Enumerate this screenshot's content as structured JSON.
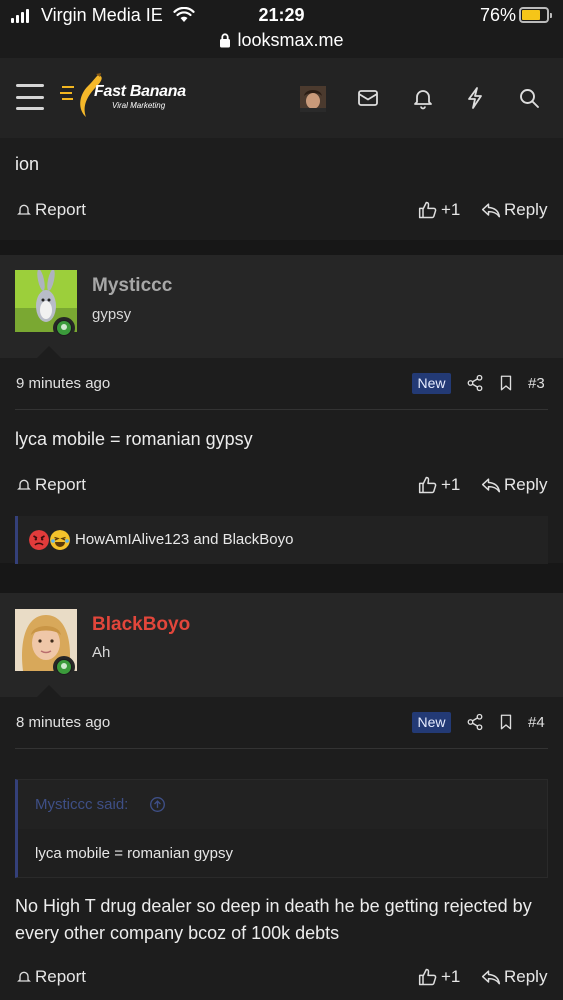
{
  "status_bar": {
    "carrier": "Virgin Media IE",
    "time": "21:29",
    "battery": "76%",
    "battery_level": 0.76,
    "url": "looksmax.me"
  },
  "nav": {
    "logo_title": "Fast Banana",
    "logo_subtitle": "Viral Marketing",
    "icons": [
      "menu-icon",
      "avatar",
      "inbox-icon",
      "bell-icon",
      "bolt-icon",
      "search-icon"
    ]
  },
  "top_post": {
    "text": "ion",
    "report": "Report",
    "like": "+1",
    "reply": "Reply"
  },
  "posts": [
    {
      "username": "Mysticcc",
      "user_title": "gypsy",
      "username_color": "#a7a7a7",
      "time": "9 minutes ago",
      "badge": "New",
      "number": "#3",
      "text": "lyca mobile = romanian gypsy",
      "report": "Report",
      "like": "+1",
      "reply": "Reply",
      "reactions": "HowAmIAlive123 and BlackBoyo",
      "reaction_icons": [
        "angry-face-icon",
        "crying-laughing-face-icon"
      ]
    },
    {
      "username": "BlackBoyo",
      "user_title": "Ah",
      "username_color": "#e2463b",
      "time": "8 minutes ago",
      "badge": "New",
      "number": "#4",
      "quote_author": "Mysticcc said:",
      "quote_text": "lyca mobile = romanian gypsy",
      "text": "No High T drug dealer so deep in death he be getting rejected by every other company bcoz of 100k debts",
      "report": "Report",
      "like": "+1",
      "reply": "Reply"
    }
  ]
}
